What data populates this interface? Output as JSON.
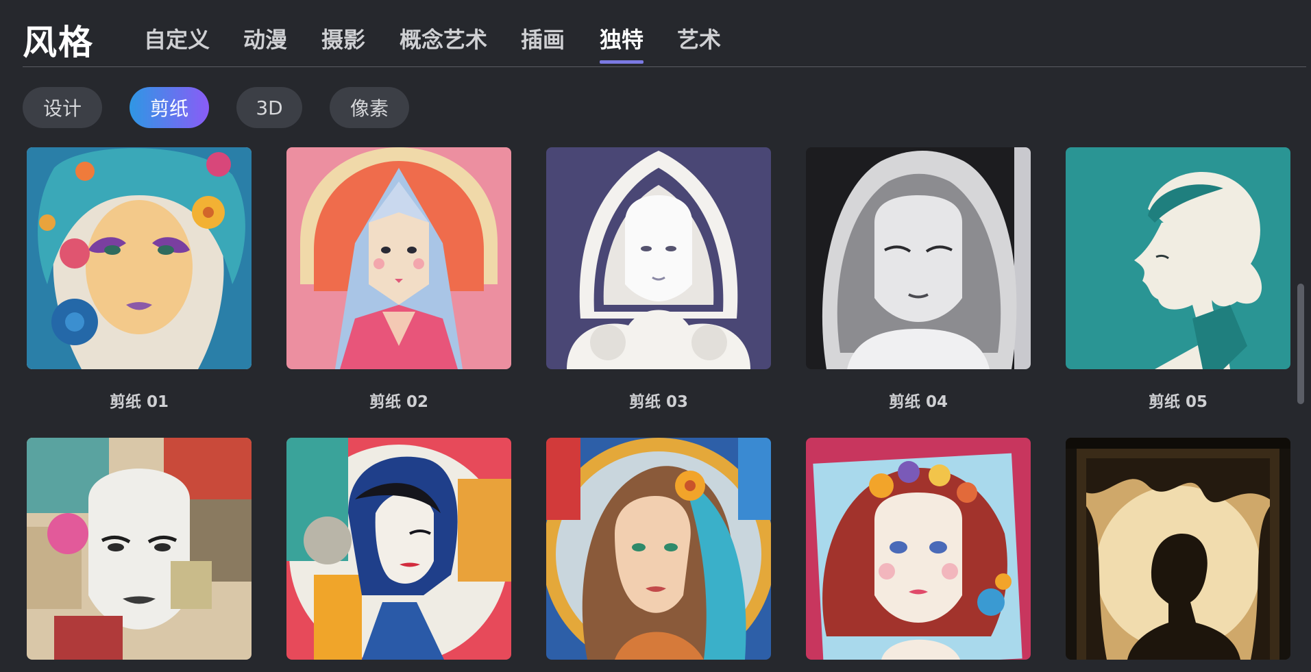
{
  "header": {
    "title": "风格",
    "tabs": [
      {
        "label": "自定义",
        "active": false
      },
      {
        "label": "动漫",
        "active": false
      },
      {
        "label": "摄影",
        "active": false
      },
      {
        "label": "概念艺术",
        "active": false
      },
      {
        "label": "插画",
        "active": false
      },
      {
        "label": "独特",
        "active": true
      },
      {
        "label": "艺术",
        "active": false
      }
    ]
  },
  "subcategories": [
    {
      "label": "设计",
      "active": false
    },
    {
      "label": "剪纸",
      "active": true
    },
    {
      "label": "3D",
      "active": false
    },
    {
      "label": "像素",
      "active": false
    }
  ],
  "styles": [
    {
      "label": "剪纸 01",
      "image": "colorful-floral-girl-portrait"
    },
    {
      "label": "剪纸 02",
      "image": "origami-girl-portrait"
    },
    {
      "label": "剪纸 03",
      "image": "white-filigree-papercut-girl"
    },
    {
      "label": "剪纸 04",
      "image": "layered-white-paper-girl"
    },
    {
      "label": "剪纸 05",
      "image": "teal-paper-profile-silhouette"
    },
    {
      "label": "",
      "image": "collage-woman-portrait"
    },
    {
      "label": "",
      "image": "abstract-geometric-woman"
    },
    {
      "label": "",
      "image": "stained-glass-woman"
    },
    {
      "label": "",
      "image": "quilling-paper-girl"
    },
    {
      "label": "",
      "image": "shadowbox-tree-silhouette"
    }
  ],
  "colors": {
    "background": "#26282d",
    "accent": "#7b79e2",
    "chip_gradient_start": "#2f97e4",
    "chip_gradient_end": "#8a5cf6"
  }
}
